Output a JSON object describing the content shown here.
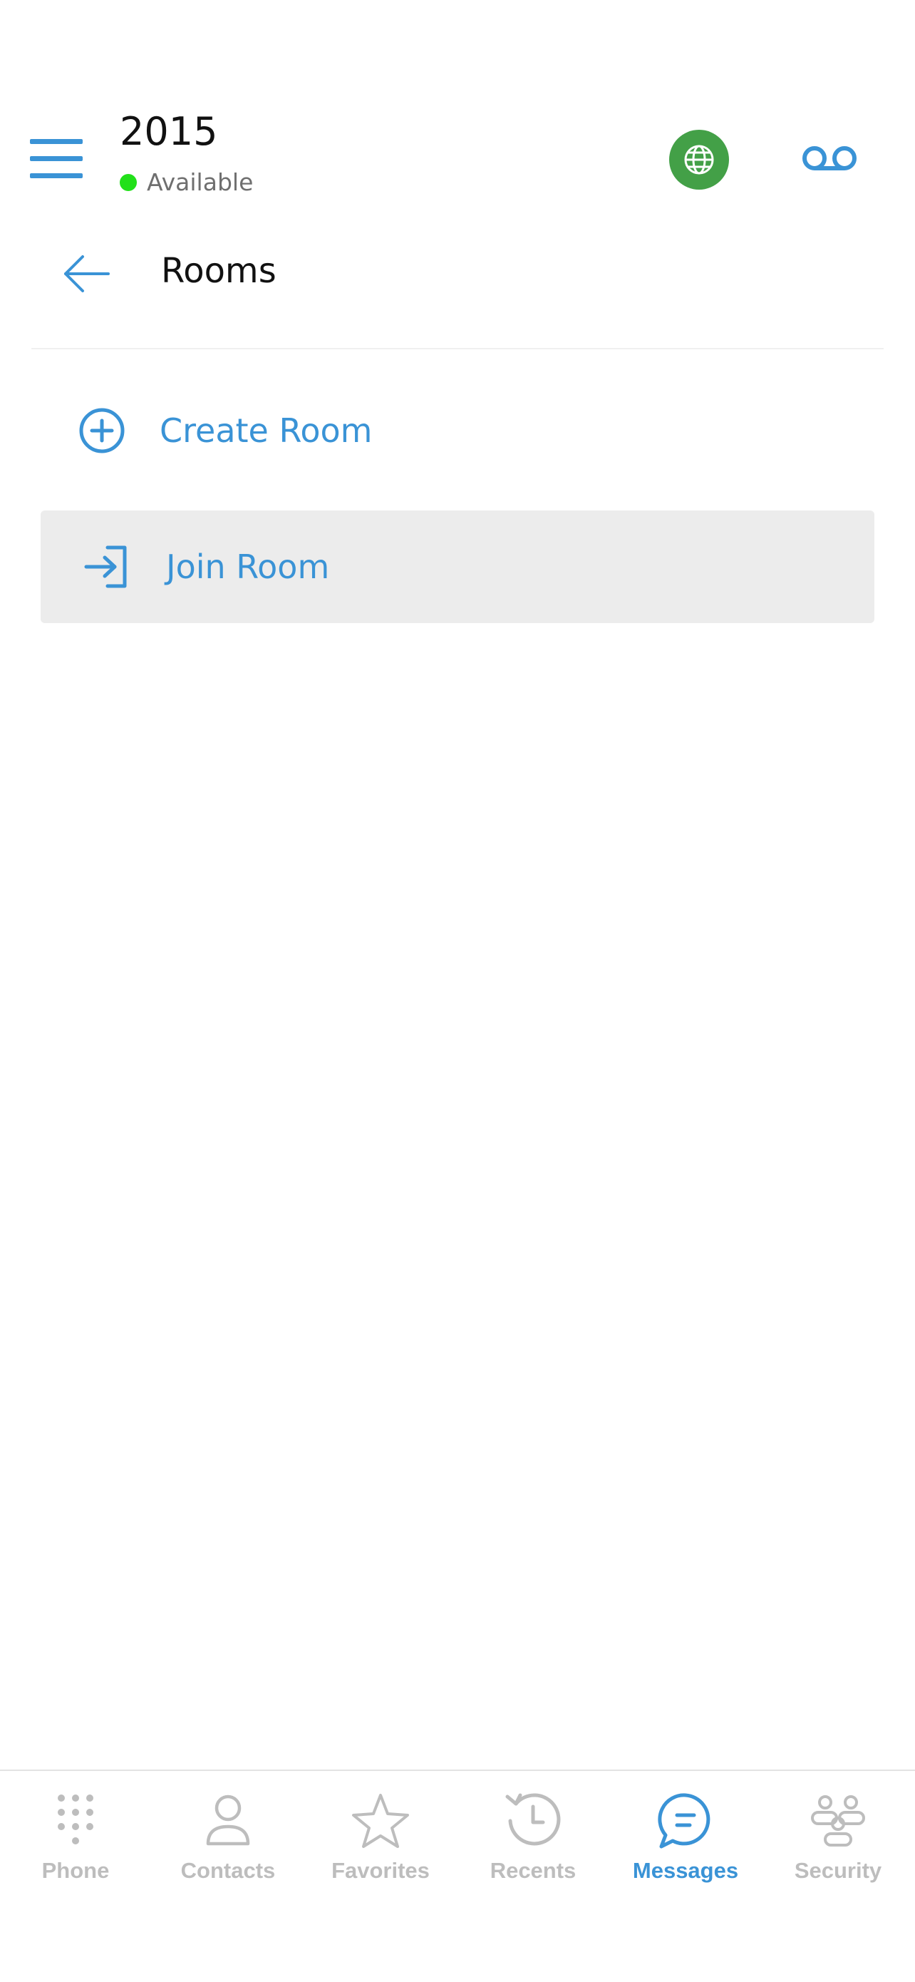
{
  "colors": {
    "accent": "#3a93d6",
    "inactive": "#bdbdbd",
    "available": "#22e01a",
    "globe_bg": "#43a047",
    "join_bg": "#ececec"
  },
  "header": {
    "extension": "2015",
    "status": "Available"
  },
  "subheader": {
    "title": "Rooms"
  },
  "actions": {
    "create_room": "Create Room",
    "join_room": "Join Room"
  },
  "bottom_nav": [
    {
      "label": "Phone",
      "icon": "dialpad-icon",
      "active": false
    },
    {
      "label": "Contacts",
      "icon": "contact-icon",
      "active": false
    },
    {
      "label": "Favorites",
      "icon": "star-icon",
      "active": false
    },
    {
      "label": "Recents",
      "icon": "history-icon",
      "active": false
    },
    {
      "label": "Messages",
      "icon": "chat-icon",
      "active": true
    },
    {
      "label": "Security",
      "icon": "group-icon",
      "active": false
    }
  ]
}
